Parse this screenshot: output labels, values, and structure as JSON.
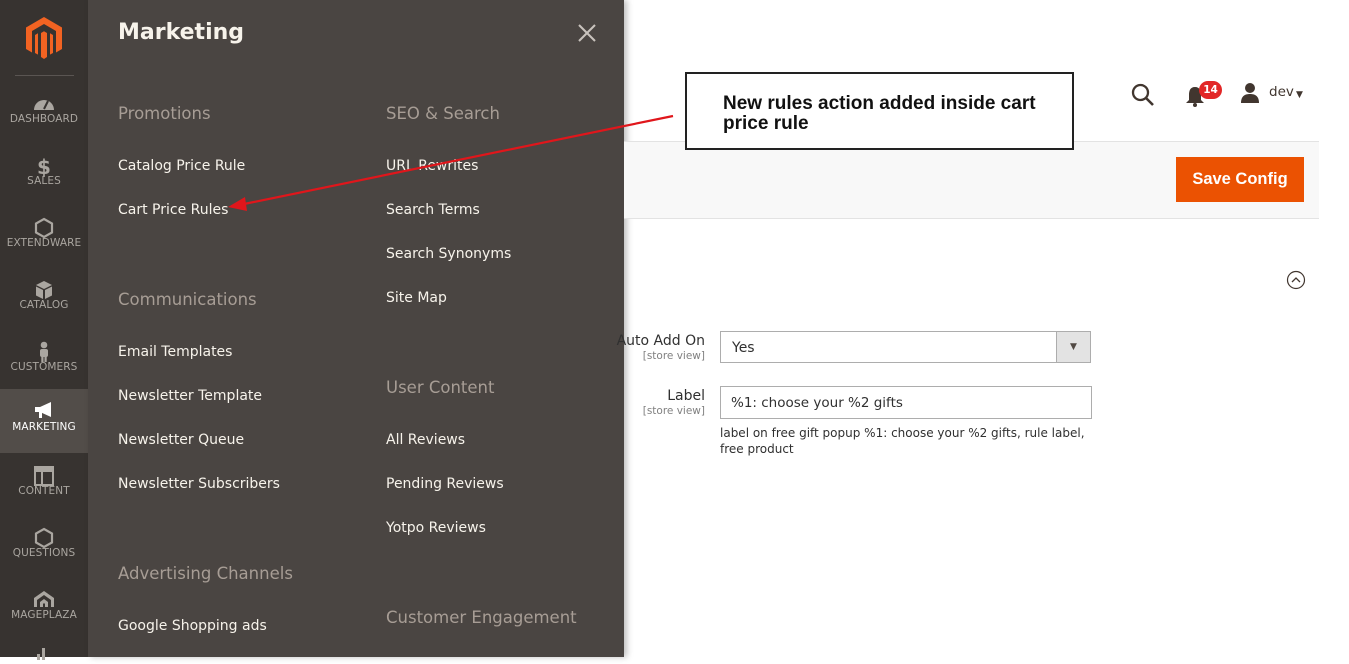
{
  "nav": {
    "items": [
      {
        "label": "DASHBOARD",
        "icon": "dashboard-gauge-icon"
      },
      {
        "label": "SALES",
        "icon": "dollar-icon"
      },
      {
        "label": "EXTENDWARE",
        "icon": "hexagon-icon"
      },
      {
        "label": "CATALOG",
        "icon": "box-icon"
      },
      {
        "label": "CUSTOMERS",
        "icon": "person-icon"
      },
      {
        "label": "MARKETING",
        "icon": "megaphone-icon",
        "active": true
      },
      {
        "label": "CONTENT",
        "icon": "layout-icon"
      },
      {
        "label": "QUESTIONS",
        "icon": "hexagon-icon"
      },
      {
        "label": "MAGEPLAZA",
        "icon": "mageplaza-logo-icon"
      }
    ]
  },
  "flyout": {
    "title": "Marketing",
    "sections": {
      "promotions": {
        "title": "Promotions",
        "links": [
          "Catalog Price Rule",
          "Cart Price Rules"
        ]
      },
      "communications": {
        "title": "Communications",
        "links": [
          "Email Templates",
          "Newsletter Template",
          "Newsletter Queue",
          "Newsletter Subscribers"
        ]
      },
      "advertising": {
        "title": "Advertising Channels",
        "links": [
          "Google Shopping ads"
        ]
      },
      "seo": {
        "title": "SEO & Search",
        "links": [
          "URL Rewrites",
          "Search Terms",
          "Search Synonyms",
          "Site Map"
        ]
      },
      "user_content": {
        "title": "User Content",
        "links": [
          "All Reviews",
          "Pending Reviews",
          "Yotpo Reviews"
        ]
      },
      "customer_engagement": {
        "title": "Customer Engagement"
      }
    }
  },
  "header": {
    "notification_count": "14",
    "user_name": "dev"
  },
  "actions": {
    "save_label": "Save Config"
  },
  "form": {
    "auto_add": {
      "label": "Auto Add On",
      "scope": "[store view]",
      "value": "Yes"
    },
    "label_field": {
      "label": "Label",
      "scope": "[store view]",
      "value": "%1: choose your %2 gifts",
      "note": "label on free gift popup %1: choose your %2 gifts, rule label, free product"
    }
  },
  "annotation": {
    "text": "New rules action added inside cart price rule"
  },
  "colors": {
    "accent": "#eb5202",
    "nav_bg": "#373330",
    "flyout_bg": "#4a4542",
    "badge": "#e22626",
    "annotation_arrow": "#e0161b"
  }
}
